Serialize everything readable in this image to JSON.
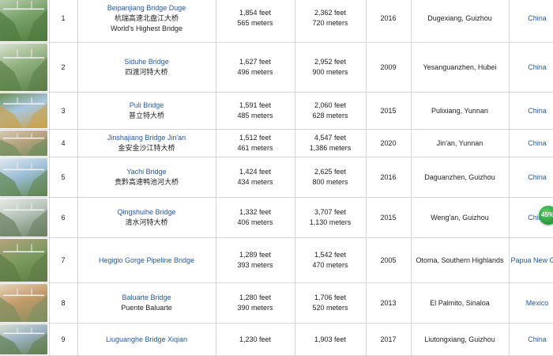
{
  "rows": [
    {
      "rank": "1",
      "name": "Beipanjiang Bridge Duge",
      "cn": "杭瑞高速北盘江大桥",
      "note": "World's Highest Bridge",
      "height_ft": "1,854 feet",
      "height_m": "565 meters",
      "span_ft": "2,362 feet",
      "span_m": "720 meters",
      "year": "2016",
      "location": "Dugexiang, Guizhou",
      "country": "China",
      "img": "bridge-photo"
    },
    {
      "rank": "2",
      "name": "Siduhe Bridge",
      "cn": "四渡河特大桥",
      "note": "",
      "height_ft": "1,627 feet",
      "height_m": "496 meters",
      "span_ft": "2,952 feet",
      "span_m": "900 meters",
      "year": "2009",
      "location": "Yesanguanzhen, Hubei",
      "country": "China",
      "img": "bridge-photo"
    },
    {
      "rank": "3",
      "name": "Puli Bridge",
      "cn": "普立特大桥",
      "note": "",
      "height_ft": "1,591 feet",
      "height_m": "485 meters",
      "span_ft": "2,060 feet",
      "span_m": "628 meters",
      "year": "2015",
      "location": "Pulixiang, Yunnan",
      "country": "China",
      "img": "bridge-photo"
    },
    {
      "rank": "4",
      "name": "Jinshajiang Bridge Jin'an",
      "cn": "金安金沙江特大桥",
      "note": "",
      "height_ft": "1,512 feet",
      "height_m": "461 meters",
      "span_ft": "4,547 feet",
      "span_m": "1,386 meters",
      "year": "2020",
      "location": "Jin'an, Yunnan",
      "country": "China",
      "img": "bridge-photo"
    },
    {
      "rank": "5",
      "name": "Yachi Bridge",
      "cn": "贵黔高速鸭池河大桥",
      "note": "",
      "height_ft": "1,424 feet",
      "height_m": "434 meters",
      "span_ft": "2,625 feet",
      "span_m": "800 meters",
      "year": "2016",
      "location": "Daguanzhen, Guizhou",
      "country": "China",
      "img": "bridge-photo"
    },
    {
      "rank": "6",
      "name": "Qingshuihe Bridge",
      "cn": "清水河特大桥",
      "note": "",
      "height_ft": "1,332 feet",
      "height_m": "406 meters",
      "span_ft": "3,707 feet",
      "span_m": "1,130 meters",
      "year": "2015",
      "location": "Weng'an, Guizhou",
      "country": "China",
      "img": "bridge-photo"
    },
    {
      "rank": "7",
      "name": "Hegigio Gorge Pipeline Bridge",
      "cn": "",
      "note": "",
      "height_ft": "1,289 feet",
      "height_m": "393 meters",
      "span_ft": "1,542 feet",
      "span_m": "470 meters",
      "year": "2005",
      "location": "Otoma, Southern Highlands",
      "country": "Papua New Guinea",
      "img": "bridge-photo"
    },
    {
      "rank": "8",
      "name": "Baluarte Bridge",
      "cn": "Puente Baluarte",
      "note": "",
      "height_ft": "1,280 feet",
      "height_m": "390 meters",
      "span_ft": "1,706 feet",
      "span_m": "520 meters",
      "year": "2013",
      "location": "El Palmito, Sinaloa",
      "country": "Mexico",
      "img": "bridge-photo"
    },
    {
      "rank": "9",
      "name": "Liuguanghe Bridge Xiqian",
      "cn": "",
      "note": "",
      "height_ft": "1,230 feet",
      "height_m": "",
      "span_ft": "1,903 feet",
      "span_m": "",
      "year": "2017",
      "location": "Liutongxiang, Guizhou",
      "country": "China",
      "img": "bridge-photo"
    }
  ],
  "badge": {
    "label": "45%"
  },
  "colors": {
    "link": "#2459a8",
    "border": "#d6d6d6"
  }
}
